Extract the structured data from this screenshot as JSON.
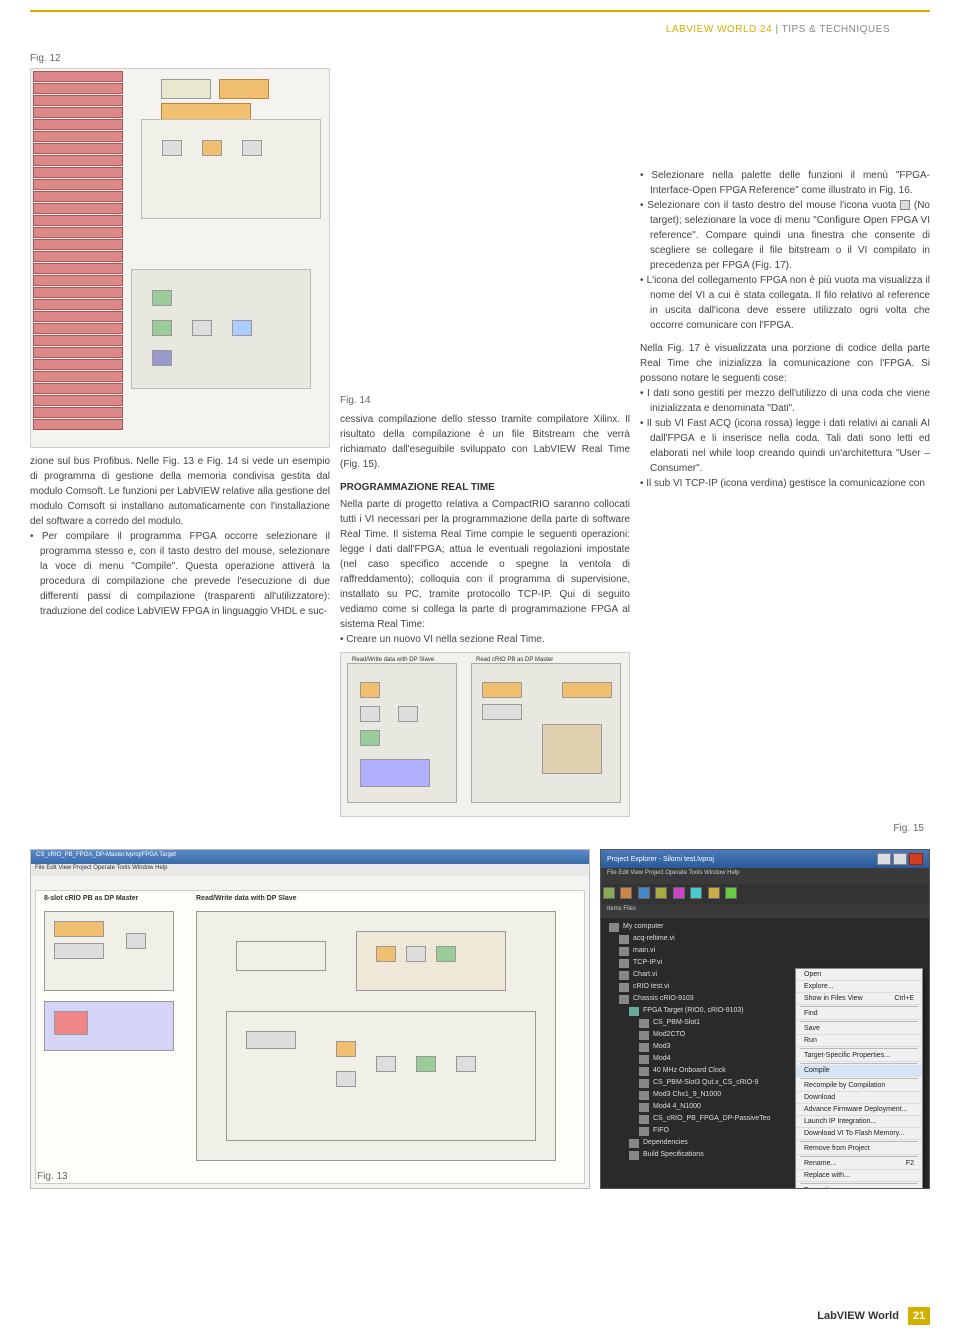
{
  "header": {
    "mag": "LABVIEW WORLD 24",
    "sep": " | ",
    "section": "TIPS & TECHNIQUES"
  },
  "figures": {
    "fig12": "Fig. 12",
    "fig13": "Fig. 13",
    "fig14": "Fig. 14",
    "fig15": "Fig. 15"
  },
  "col1": {
    "p1": "zione sul bus Profibus. Nelle Fig. 13 e Fig. 14 si vede un esempio di programma di gestione della memoria condivisa gestita dal modulo Comsoft. Le funzioni per LabVIEW relative alla gestione del modulo Comsoft si installano automaticamente con l'installazione del software a corredo del modulo.",
    "b1": "Per compilare il programma FPGA occorre selezionare il programma stesso e, con il tasto destro del mouse, selezionare la voce di menu \"Compile\". Questa operazione attiverà la procedura di compilazione che prevede l'esecuzione di due differenti passi di compilazione (trasparenti all'utilizzatore): traduzione del codice LabVIEW FPGA in linguaggio VHDL e suc-"
  },
  "col2": {
    "p1": "cessiva compilazione dello stesso tramite compilatore Xilinx. Il risultato della compilazione è un file Bitstream che verrà richiamato dall'eseguibile sviluppato con LabVIEW Real Time (Fig. 15).",
    "h1": "PROGRAMMAZIONE REAL TIME",
    "p2": "Nella parte di progetto relativa a CompactRIO saranno collocati tutti i VI necessari per la programmazione della parte di software Real Time. Il sistema Real Time compie le seguenti operazioni: legge i dati dall'FPGA; attua le eventuali regolazioni impostate (nel caso specifico accende o spegne la ventola di raffreddamento); colloquia con il programma di supervisione, installato su PC, tramite protocollo TCP-IP. Qui di seguito vediamo come si collega la parte di programmazione FPGA al sistema Real Time:",
    "b1": "Creare un nuovo VI nella sezione Real Time."
  },
  "col3": {
    "b1": "Selezionare nella palette delle funzioni il menù \"FPGA-Interface-Open FPGA Reference\" come illustrato in Fig. 16.",
    "b2a": "Selezionare con il tasto destro del mouse l'icona vuota ",
    "b2b": " (No target); selezionare la voce di menu \"Configure Open FPGA VI reference\". Compare quindi una finestra che consente di scegliere se collegare il file bitstream o il VI compilato in precedenza per FPGA (Fig. 17).",
    "b3": "L'icona del collegamento FPGA non è più vuota ma visualizza il nome del VI a cui è stata collegata. Il filo relativo al reference in uscita dall'icona deve essere utilizzato ogni volta che occorre comunicare con l'FPGA.",
    "p1": "Nella Fig. 17 è visualizzata una porzione di codice della parte Real Time che inizializza la comunicazione con l'FPGA. Si possono notare le seguenti cose:",
    "b4": "I dati sono gestiti per mezzo dell'utilizzo di una coda che viene inizializzata e denominata \"Dati\".",
    "b5": "Il sub VI Fast ACQ (icona rossa) legge i dati relativi ai canali AI dall'FPGA e li inserisce nella coda. Tali dati sono letti ed elaborati nel while loop creando quindi un'architettura \"User – Consumer\".",
    "b6": "Il sub VI TCP-IP (icona verdina) gestisce la comunicazione con"
  },
  "fig13content": {
    "title": "CS_cRIO_PB_FPGA_DP-Master.lvproj/FPGA Target",
    "block_label": "8-slot cRIO PB as DP Master",
    "rw_label": "Read/Write data with DP Slave"
  },
  "fig14content": {
    "label1": "Read cRIO PB as DP Master",
    "label2": "Read/Write data with DP Slave"
  },
  "fig15content": {
    "title": "Project Explorer - Silomi test.lvproj",
    "menubar": "File  Edit  View  Project  Operate  Tools  Window  Help",
    "cols": "Items    Files",
    "tree": [
      "My computer",
      "acq-reltime.vi",
      "main.vi",
      "TCP-IP.vi",
      "Chart.vi",
      "cRIO test.vi",
      "Chassis cRIO-9103",
      "FPGA Target (RIO0, cRIO-9103)",
      "CS_PBM-Slot1",
      "Mod2CTO",
      "Mod3",
      "Mod4",
      "40 MHz Onboard Clock",
      "CS_PBM-Slot3 Qut.x_CS_cRIO-9",
      "Mod3 Chx1_9_N1000",
      "Mod4 4_N1000",
      "CS_cRIO_PB_FPGA_DP-PassiveTeo",
      "FIFO",
      "Dependencies",
      "Build Specifications"
    ],
    "menu": [
      "Open",
      "Explore...",
      "Show in Files View",
      "Find",
      "Save",
      "Run",
      "Target-Specific Properties...",
      "Compile",
      "Recompile by Compilation",
      "Download",
      "Advance Firmware Deployment...",
      "Launch IP Integration...",
      "Download VI To Flash Memory...",
      "Remove from Project",
      "Rename...",
      "Replace with...",
      "Properties"
    ],
    "shortcut": "Ctrl+E",
    "f2": "F2"
  },
  "footer": {
    "mag": "LabVIEW World",
    "page": "21"
  }
}
